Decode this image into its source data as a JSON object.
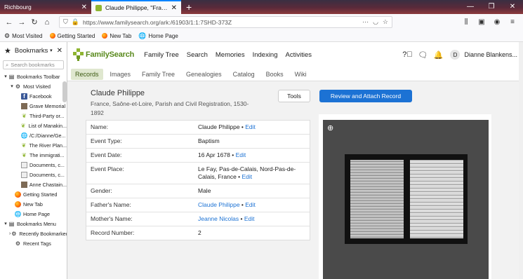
{
  "browser": {
    "tabs": [
      {
        "label": "Richbourg"
      },
      {
        "label": "Claude Philippe, \"France, Saône-et-Loire..."
      }
    ],
    "new_tab": "+",
    "url": "https://www.familysearch.org/ark:/61903/1:1:7SHD-373Z",
    "bookmarks_toolbar": [
      "Most Visited",
      "Getting Started",
      "New Tab",
      "Home Page"
    ]
  },
  "sidebar": {
    "title": "Bookmarks",
    "search_placeholder": "Search bookmarks",
    "items": [
      {
        "label": "Bookmarks Toolbar",
        "indent": 0,
        "twisty": "▾",
        "icon": "folder"
      },
      {
        "label": "Most Visited",
        "indent": 1,
        "twisty": "▾",
        "icon": "gear"
      },
      {
        "label": "Facebook",
        "indent": 2,
        "twisty": "",
        "icon": "facebook"
      },
      {
        "label": "Grave Memorial",
        "indent": 2,
        "twisty": "",
        "icon": "image"
      },
      {
        "label": "Third-Party or...",
        "indent": 2,
        "twisty": "",
        "icon": "leaf"
      },
      {
        "label": "List of Manakin...",
        "indent": 2,
        "twisty": "",
        "icon": "leaf"
      },
      {
        "label": "/C:/Dianne/Ge...",
        "indent": 2,
        "twisty": "",
        "icon": "globe"
      },
      {
        "label": "The River Plan...",
        "indent": 2,
        "twisty": "",
        "icon": "leaf"
      },
      {
        "label": "The immigrati...",
        "indent": 2,
        "twisty": "",
        "icon": "leaf"
      },
      {
        "label": "Documents, c...",
        "indent": 2,
        "twisty": "",
        "icon": "doc"
      },
      {
        "label": "Documents, c...",
        "indent": 2,
        "twisty": "",
        "icon": "doc"
      },
      {
        "label": "Anne Chastain...",
        "indent": 2,
        "twisty": "",
        "icon": "image"
      },
      {
        "label": "Getting Started",
        "indent": 1,
        "twisty": "",
        "icon": "firefox"
      },
      {
        "label": "New Tab",
        "indent": 1,
        "twisty": "",
        "icon": "firefox"
      },
      {
        "label": "Home Page",
        "indent": 1,
        "twisty": "",
        "icon": "globe"
      },
      {
        "label": "Bookmarks Menu",
        "indent": 0,
        "twisty": "▾",
        "icon": "folder"
      },
      {
        "label": "Recently Bookmarked",
        "indent": 1,
        "twisty": "›",
        "icon": "gear"
      },
      {
        "label": "Recent Tags",
        "indent": 1,
        "twisty": "",
        "icon": "gear"
      }
    ]
  },
  "site": {
    "logo": "FamilySearch",
    "nav": [
      "Family Tree",
      "Search",
      "Memories",
      "Indexing",
      "Activities"
    ],
    "user": {
      "initial": "D",
      "name": "Dianne Blankens..."
    },
    "subnav": [
      "Records",
      "Images",
      "Family Tree",
      "Genealogies",
      "Catalog",
      "Books",
      "Wiki"
    ],
    "subnav_selected": "Records"
  },
  "record": {
    "name": "Claude Philippe",
    "collection": "France, Saône-et-Loire, Parish and Civil Registration, 1530-1892",
    "tools_label": "Tools",
    "review_label": "Review and Attach Record",
    "edit_label": "Edit",
    "fields": [
      {
        "key": "Name:",
        "value": "Claude Philippe",
        "link": false,
        "edit": true
      },
      {
        "key": "Event Type:",
        "value": "Baptism",
        "link": false,
        "edit": false
      },
      {
        "key": "Event Date:",
        "value": "16 Apr 1678",
        "link": false,
        "edit": true
      },
      {
        "key": "Event Place:",
        "value": "Le Fay, Pas-de-Calais, Nord-Pas-de-Calais, France",
        "link": false,
        "edit": true
      },
      {
        "key": "Gender:",
        "value": "Male",
        "link": false,
        "edit": false
      },
      {
        "key": "Father's Name:",
        "value": "Claude Philippe",
        "link": true,
        "edit": true
      },
      {
        "key": "Mother's Name:",
        "value": "Jeanne Nicolas",
        "link": true,
        "edit": true
      },
      {
        "key": "Record Number:",
        "value": "2",
        "link": false,
        "edit": false
      }
    ]
  },
  "colors": {
    "accent": "#1c72d4",
    "brand_green": "#8fb531"
  }
}
